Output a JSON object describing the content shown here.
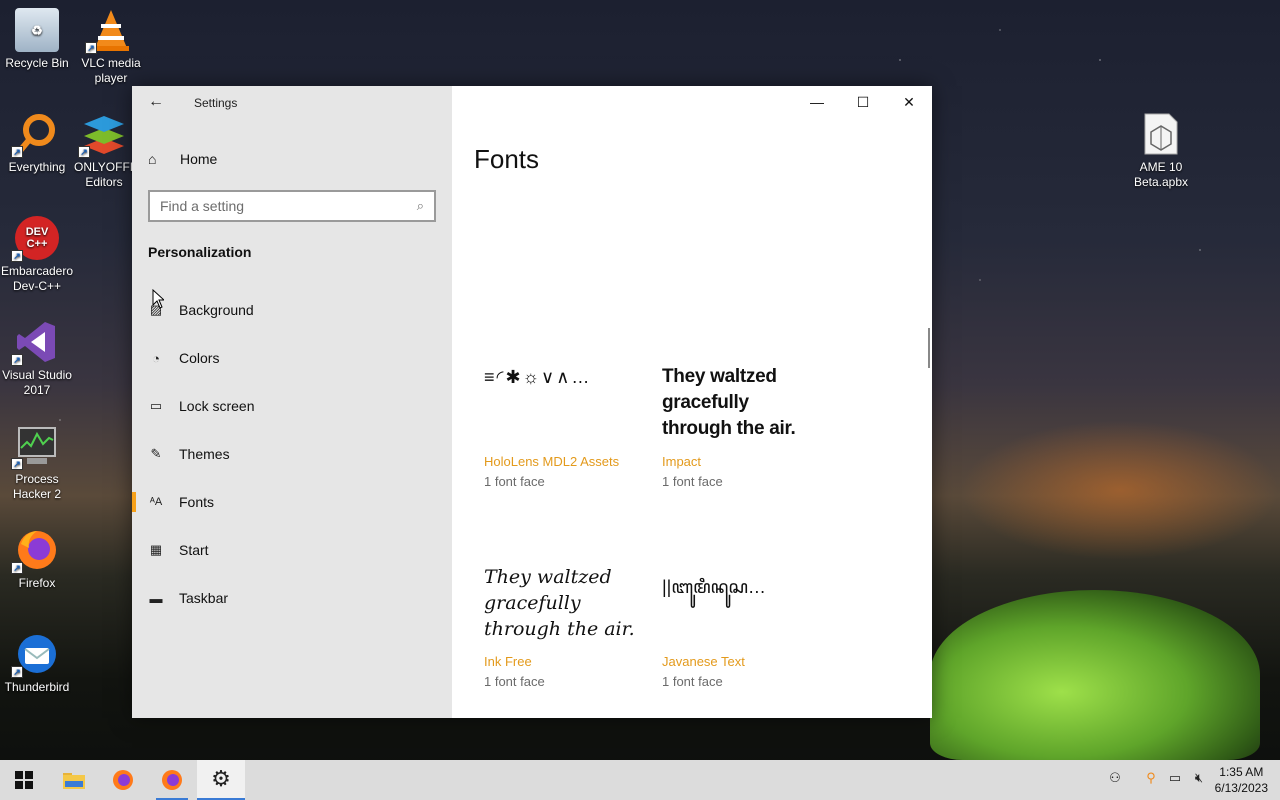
{
  "desktop": {
    "icons": [
      {
        "label": "Recycle Bin",
        "icon": "recycle-bin-icon"
      },
      {
        "label": "VLC media player",
        "icon": "vlc-icon"
      },
      {
        "label": "Everything",
        "icon": "everything-search-icon"
      },
      {
        "label": "ONLYOFFICE Editors",
        "icon": "onlyoffice-icon"
      },
      {
        "label": "Embarcadero Dev-C++",
        "icon": "devcpp-icon",
        "glyph": "DEV C++"
      },
      {
        "label": "Visual Studio 2017",
        "icon": "visual-studio-icon"
      },
      {
        "label": "Process Hacker 2",
        "icon": "process-hacker-icon"
      },
      {
        "label": "Firefox",
        "icon": "firefox-icon"
      },
      {
        "label": "Thunderbird",
        "icon": "thunderbird-icon"
      },
      {
        "label": "AME 10 Beta.apbx",
        "icon": "apbx-file-icon"
      }
    ]
  },
  "settings": {
    "title": "Settings",
    "home_label": "Home",
    "search_placeholder": "Find a setting",
    "section": "Personalization",
    "nav": [
      {
        "label": "Background",
        "icon": "picture-icon",
        "glyph": "▨"
      },
      {
        "label": "Colors",
        "icon": "palette-icon",
        "glyph": "◔"
      },
      {
        "label": "Lock screen",
        "icon": "lock-screen-icon",
        "glyph": "▭"
      },
      {
        "label": "Themes",
        "icon": "themes-icon",
        "glyph": "✎"
      },
      {
        "label": "Fonts",
        "icon": "fonts-icon",
        "glyph": "ᴬA",
        "active": true
      },
      {
        "label": "Start",
        "icon": "start-icon",
        "glyph": "▦"
      },
      {
        "label": "Taskbar",
        "icon": "taskbar-icon",
        "glyph": "▬"
      }
    ],
    "page_title": "Fonts",
    "fonts": [
      {
        "preview": "≡◜✱☼∨∧…",
        "name": "HoloLens MDL2 Assets",
        "faces": "1 font face"
      },
      {
        "preview": "They waltzed gracefully through the air.",
        "name": "Impact",
        "faces": "1 font face"
      },
      {
        "preview": "They waltzed gracefully through the air.",
        "name": "Ink Free",
        "faces": "1 font face"
      },
      {
        "preview": "||ꦧꦸꦩꦶꦤꦸꦱ…",
        "name": "Javanese Text",
        "faces": "1 font face"
      }
    ]
  },
  "taskbar": {
    "time": "1:35 AM",
    "date": "6/13/2023"
  }
}
